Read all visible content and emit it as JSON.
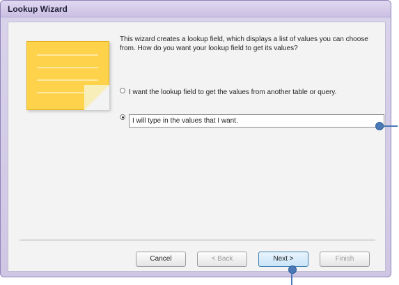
{
  "window": {
    "title": "Lookup Wizard"
  },
  "intro": {
    "text": "This wizard creates a lookup field, which displays a list of values you can choose from. How do you want your lookup field to get its values?"
  },
  "options": [
    {
      "label": "I want the lookup field to get the values from another table or query.",
      "selected": false
    },
    {
      "label": "I will type in the values that I want.",
      "selected": true
    }
  ],
  "buttons": {
    "cancel": "Cancel",
    "back": "< Back",
    "next": "Next >",
    "finish": "Finish"
  }
}
